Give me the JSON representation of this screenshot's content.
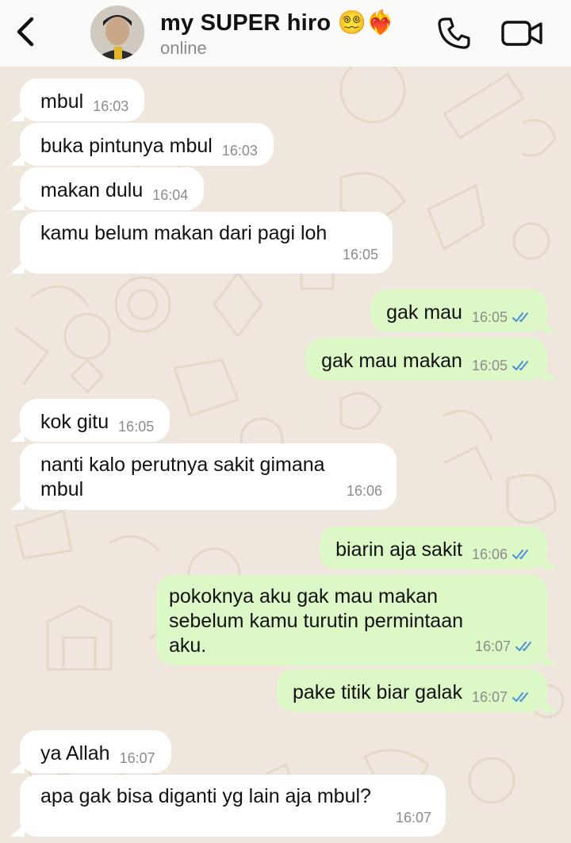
{
  "contact": {
    "name": "my SUPER hiro 😵‍💫❤️‍🔥",
    "status": "online"
  },
  "colors": {
    "incoming": "#ffffff",
    "outgoing": "#dcf8c6",
    "read_ticks": "#4d90d9",
    "background": "#efe7dd"
  },
  "icons": {
    "back": "chevron-left-icon",
    "call": "phone-icon",
    "video": "video-camera-icon",
    "read": "double-check-icon"
  },
  "messages": [
    {
      "dir": "in",
      "text": "mbul",
      "time": "16:03"
    },
    {
      "dir": "in",
      "text": "buka pintunya mbul",
      "time": "16:03"
    },
    {
      "dir": "in",
      "text": "makan dulu",
      "time": "16:04"
    },
    {
      "dir": "in",
      "text": "kamu belum makan dari pagi loh",
      "time": "16:05"
    },
    {
      "dir": "out",
      "text": "gak mau",
      "time": "16:05",
      "read": true
    },
    {
      "dir": "out",
      "text": "gak mau makan",
      "time": "16:05",
      "read": true
    },
    {
      "dir": "in",
      "text": "kok gitu",
      "time": "16:05"
    },
    {
      "dir": "in",
      "text": "nanti kalo perutnya sakit gimana\nmbul",
      "time": "16:06"
    },
    {
      "dir": "out",
      "text": "biarin aja sakit",
      "time": "16:06",
      "read": true
    },
    {
      "dir": "out",
      "text": "pokoknya aku gak mau makan\nsebelum kamu turutin permintaan\naku.",
      "time": "16:07",
      "read": true
    },
    {
      "dir": "out",
      "text": "pake titik biar galak",
      "time": "16:07",
      "read": true
    },
    {
      "dir": "in",
      "text": "ya Allah",
      "time": "16:07"
    },
    {
      "dir": "in",
      "text": "apa gak bisa diganti yg lain aja mbul?",
      "time": "16:07"
    }
  ]
}
